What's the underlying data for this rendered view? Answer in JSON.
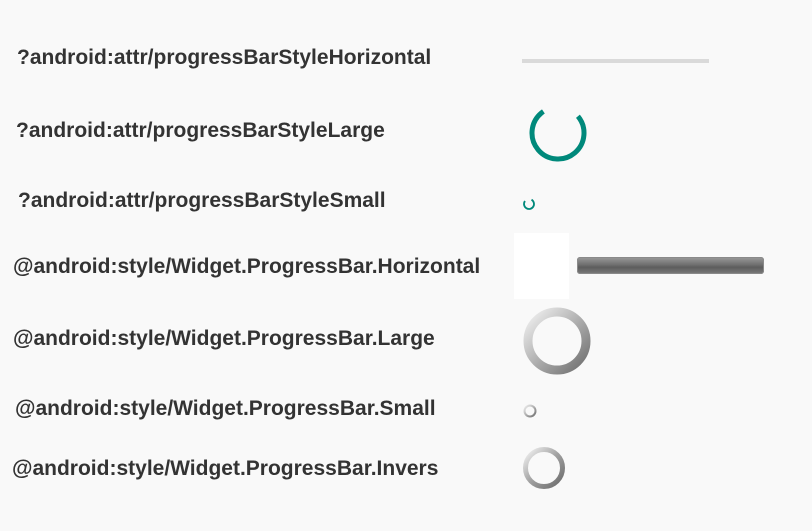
{
  "rows": [
    {
      "label": "?android:attr/progressBarStyleHorizontal",
      "widget": "material-horizontal"
    },
    {
      "label": "?android:attr/progressBarStyleLarge",
      "widget": "material-spinner-large"
    },
    {
      "label": "?android:attr/progressBarStyleSmall",
      "widget": "material-spinner-small"
    },
    {
      "label": "@android:style/Widget.ProgressBar.Horizontal",
      "widget": "legacy-horizontal"
    },
    {
      "label": "@android:style/Widget.ProgressBar.Large",
      "widget": "legacy-spinner-large"
    },
    {
      "label": "@android:style/Widget.ProgressBar.Small",
      "widget": "legacy-spinner-small"
    },
    {
      "label": "@android:style/Widget.ProgressBar.Invers",
      "widget": "legacy-spinner-inverse"
    }
  ],
  "colors": {
    "background": "#f9f9f9",
    "label": "#333333",
    "accent": "#00897b",
    "track": "#dadada",
    "legacy_ring": "#8c8c8c"
  }
}
